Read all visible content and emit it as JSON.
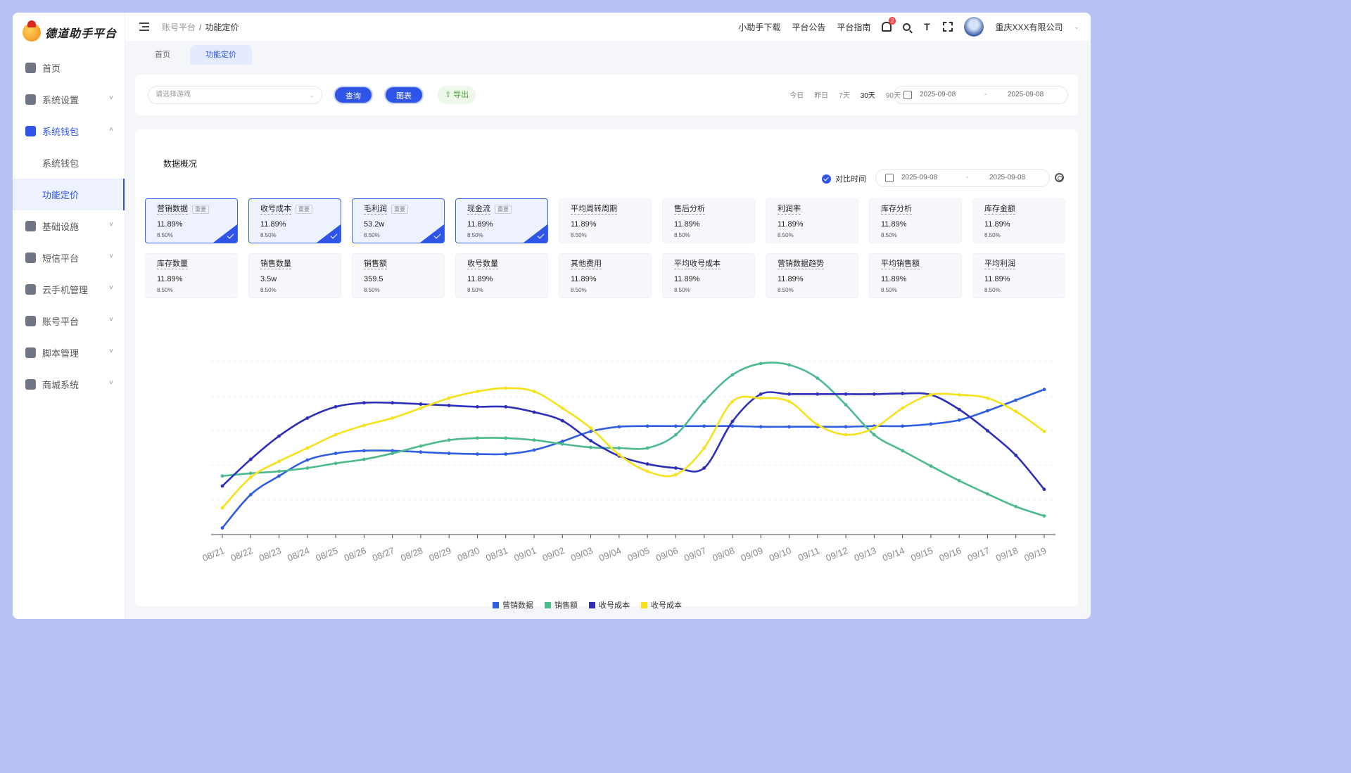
{
  "app": {
    "title": "德道助手平台"
  },
  "sidebar": {
    "items": [
      {
        "label": "首页",
        "icon": "home-icon",
        "expandable": false
      },
      {
        "label": "系统设置",
        "icon": "gear-icon",
        "expandable": true
      },
      {
        "label": "系统钱包",
        "icon": "wallet-icon",
        "expandable": true,
        "open": true,
        "children": [
          {
            "label": "系统钱包"
          },
          {
            "label": "功能定价",
            "active": true
          }
        ]
      },
      {
        "label": "基础设施",
        "icon": "chart-icon",
        "expandable": true
      },
      {
        "label": "短信平台",
        "icon": "message-icon",
        "expandable": true
      },
      {
        "label": "云手机管理",
        "icon": "cloud-phone-icon",
        "expandable": true
      },
      {
        "label": "账号平台",
        "icon": "user-icon",
        "expandable": true
      },
      {
        "label": "脚本管理",
        "icon": "code-icon",
        "expandable": true
      },
      {
        "label": "商城系统",
        "icon": "shop-icon",
        "expandable": true
      }
    ]
  },
  "header": {
    "breadcrumb": [
      "账号平台",
      "功能定价"
    ],
    "links": [
      "小助手下载",
      "平台公告",
      "平台指南"
    ],
    "notification_count": "2",
    "company": "重庆XXX有限公司"
  },
  "tabs": [
    "首页",
    "功能定价"
  ],
  "toolbar": {
    "game_placeholder": "请选择游戏",
    "query_label": "查询",
    "chart_label": "图表",
    "export_label": "导出",
    "ranges": [
      "今日",
      "昨日",
      "7天",
      "30天",
      "90天"
    ],
    "active_range": "30天",
    "start_date": "2025-09-08",
    "date_separator": "-",
    "end_date": "2025-09-08"
  },
  "panel": {
    "title": "数据概况",
    "compare_label": "对比时间",
    "compare_start": "2025-09-08",
    "compare_end": "2025-09-08"
  },
  "metric_cards": [
    {
      "name": "营销数据",
      "tag": "重要",
      "value": "11.89%",
      "pct": "8.50%",
      "selected": true
    },
    {
      "name": "收号成本",
      "tag": "重要",
      "value": "11.89%",
      "pct": "8.50%",
      "selected": true
    },
    {
      "name": "毛利润",
      "tag": "重要",
      "value": "53.2w",
      "pct": "8.50%",
      "selected": true
    },
    {
      "name": "现金流",
      "tag": "重要",
      "value": "11.89%",
      "pct": "8.50%",
      "selected": true
    },
    {
      "name": "平均周转周期",
      "tag": "",
      "value": "11.89%",
      "pct": "8.50%",
      "selected": false
    },
    {
      "name": "售后分析",
      "tag": "",
      "value": "11.89%",
      "pct": "8.50%",
      "selected": false
    },
    {
      "name": "利润率",
      "tag": "",
      "value": "11.89%",
      "pct": "8.50%",
      "selected": false
    },
    {
      "name": "库存分析",
      "tag": "",
      "value": "11.89%",
      "pct": "8.50%",
      "selected": false
    },
    {
      "name": "库存金额",
      "tag": "",
      "value": "11.89%",
      "pct": "8.50%",
      "selected": false
    },
    {
      "name": "库存数量",
      "tag": "",
      "value": "11.89%",
      "pct": "8.50%",
      "selected": false
    },
    {
      "name": "销售数量",
      "tag": "",
      "value": "3.5w",
      "pct": "8.50%",
      "selected": false
    },
    {
      "name": "销售额",
      "tag": "",
      "value": "359.5",
      "pct": "8.50%",
      "selected": false
    },
    {
      "name": "收号数量",
      "tag": "",
      "value": "11.89%",
      "pct": "8.50%",
      "selected": false
    },
    {
      "name": "其他费用",
      "tag": "",
      "value": "11.89%",
      "pct": "8.50%",
      "selected": false
    },
    {
      "name": "平均收号成本",
      "tag": "",
      "value": "11.89%",
      "pct": "8.50%",
      "selected": false
    },
    {
      "name": "营销数据趋势",
      "tag": "",
      "value": "11.89%",
      "pct": "8.50%",
      "selected": false
    },
    {
      "name": "平均销售额",
      "tag": "",
      "value": "11.89%",
      "pct": "8.50%",
      "selected": false
    },
    {
      "name": "平均利润",
      "tag": "",
      "value": "11.89%",
      "pct": "8.50%",
      "selected": false
    }
  ],
  "chart_data": {
    "type": "line",
    "smooth": true,
    "x": [
      "08/21",
      "08/22",
      "08/23",
      "08/24",
      "08/25",
      "08/26",
      "08/27",
      "08/28",
      "08/29",
      "08/30",
      "08/31",
      "09/01",
      "09/02",
      "09/03",
      "09/04",
      "09/05",
      "09/06",
      "09/07",
      "09/08",
      "09/09",
      "09/10",
      "09/11",
      "09/12",
      "09/13",
      "09/14",
      "09/15",
      "09/16",
      "09/17",
      "09/18",
      "09/19"
    ],
    "ylim": [
      0,
      260
    ],
    "grid": true,
    "legend_position": "bottom",
    "series": [
      {
        "name": "营销数据",
        "color": "#2f5fe0",
        "values": [
          10,
          60,
          88,
          112,
          122,
          126,
          126,
          124,
          122,
          121,
          121,
          127,
          140,
          155,
          162,
          163,
          163,
          163,
          163,
          162,
          162,
          162,
          162,
          163,
          163,
          166,
          172,
          186,
          202,
          218
        ]
      },
      {
        "name": "销售额",
        "color": "#4cba8c",
        "values": [
          88,
          92,
          95,
          100,
          107,
          113,
          122,
          133,
          142,
          145,
          145,
          142,
          136,
          131,
          130,
          130,
          150,
          200,
          240,
          257,
          255,
          235,
          195,
          150,
          126,
          103,
          81,
          61,
          42,
          28
        ]
      },
      {
        "name": "收号成本",
        "color": "#2e2fb8",
        "values": [
          73,
          113,
          148,
          175,
          192,
          198,
          198,
          196,
          194,
          192,
          192,
          184,
          171,
          141,
          118,
          106,
          100,
          100,
          170,
          211,
          211,
          211,
          211,
          211,
          212,
          210,
          188,
          156,
          119,
          68
        ]
      },
      {
        "name": "收号成本",
        "color": "#f5e21d",
        "values": [
          40,
          86,
          110,
          130,
          150,
          164,
          175,
          190,
          205,
          215,
          220,
          215,
          190,
          160,
          120,
          95,
          90,
          130,
          200,
          205,
          200,
          165,
          150,
          160,
          190,
          210,
          210,
          205,
          185,
          155
        ]
      }
    ]
  }
}
